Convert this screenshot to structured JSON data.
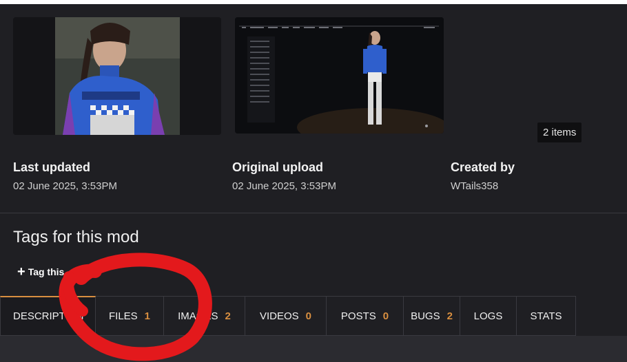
{
  "gallery": {
    "items_count": "2 items",
    "thumbs": [
      {
        "icon": "character-portrait-image"
      },
      {
        "icon": "in-game-equipment-screenshot"
      }
    ]
  },
  "meta": {
    "last_updated_label": "Last updated",
    "last_updated_value": "02 June 2025, 3:53PM",
    "original_upload_label": "Original upload",
    "original_upload_value": "02 June 2025, 3:53PM",
    "created_by_label": "Created by",
    "created_by_value": "WTails358"
  },
  "tags": {
    "heading": "Tags for this mod",
    "tag_button": "Tag this"
  },
  "tabs": [
    {
      "label": "DESCRIPTION",
      "count": ""
    },
    {
      "label": "FILES",
      "count": "1"
    },
    {
      "label": "IMAGES",
      "count": "2"
    },
    {
      "label": "VIDEOS",
      "count": "0"
    },
    {
      "label": "POSTS",
      "count": "0"
    },
    {
      "label": "BUGS",
      "count": "2"
    },
    {
      "label": "LOGS",
      "count": ""
    },
    {
      "label": "STATS",
      "count": ""
    }
  ],
  "colors": {
    "accent": "#d98f40",
    "panel": "#1f1f23",
    "annotation": "#e3191c"
  }
}
